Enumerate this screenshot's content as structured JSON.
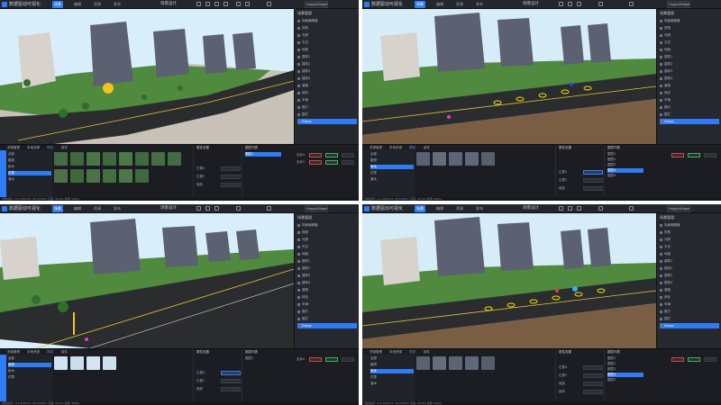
{
  "toolbar": {
    "app_title": "数据驱动可视化",
    "tabs": [
      "场景",
      "编辑",
      "资源",
      "发布"
    ],
    "scene_name": "场景设计",
    "right_box": "HappyWidget"
  },
  "right_panel": {
    "title": "场景管理",
    "items": [
      "场景编辑器",
      "视角",
      "光照",
      "天空",
      "地面",
      "建筑1",
      "建筑2",
      "建筑3",
      "建筑4",
      "道路",
      "绿化",
      "车辆",
      "路灯",
      "围栏",
      "人物",
      "标注"
    ],
    "selected_item": "Group"
  },
  "bottom": {
    "tabs": [
      "资源管理",
      "本地资源",
      "项目",
      "组件"
    ],
    "tree_items": [
      "全部",
      "植物",
      "树木",
      "花草",
      "灌木"
    ],
    "attr_title": "属性设置",
    "attr_labels": [
      "位置X",
      "位置Y",
      "缩放",
      "旋转"
    ],
    "list_title": "图层列表",
    "list_items": [
      "图层1",
      "图层2",
      "图层3",
      "图层4",
      "图层5"
    ],
    "field_labels": [
      "坐标X",
      "坐标Y",
      "坐标Z"
    ]
  },
  "status_text": "当前坐标: 112.958123, 28.204567  高度: 45.6m  帧率: 60fps",
  "colors": {
    "accent": "#2f7cf6",
    "panel_bg": "#1d1f24",
    "grass": "#4f8a3e",
    "road": "#2b2c2e",
    "sand": "#7a5e44",
    "sky": "#cfe8f7"
  }
}
